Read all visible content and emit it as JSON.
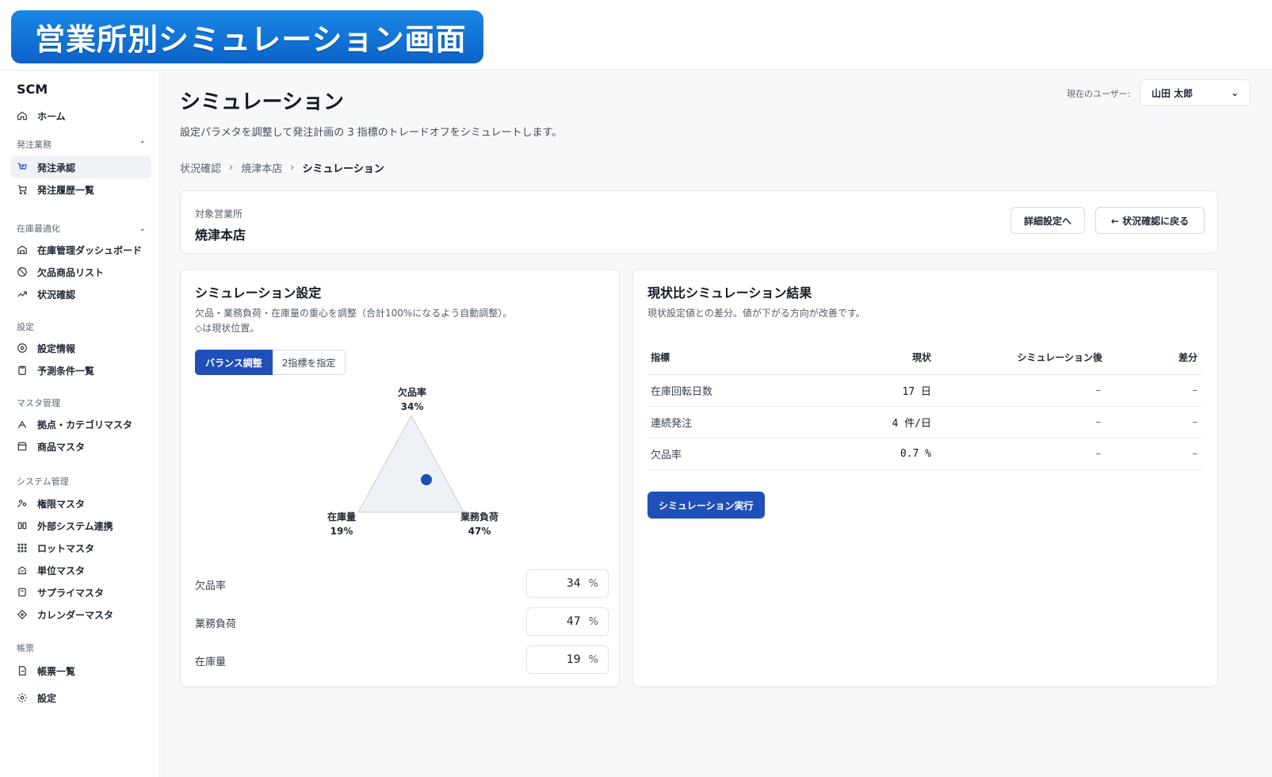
{
  "banner": {
    "title": "営業所別シミュレーション画面"
  },
  "sidebar": {
    "brand": "SCM",
    "home": "ホーム",
    "sections": [
      {
        "label": "発注業務",
        "items": [
          "発注承認",
          "発注履歴一覧"
        ]
      },
      {
        "label": "在庫最適化",
        "items": [
          "在庫管理ダッシュボード",
          "欠品商品リスト",
          "状況確認"
        ]
      },
      {
        "label": "設定",
        "items": [
          "設定情報",
          "予測条件一覧"
        ]
      },
      {
        "label": "マスタ管理",
        "items": [
          "拠点・カテゴリマスタ",
          "商品マスタ"
        ]
      },
      {
        "label": "システム管理",
        "items": [
          "権限マスタ",
          "外部システム連携",
          "ロットマスタ",
          "単位マスタ",
          "サプライマスタ",
          "カレンダーマスタ"
        ]
      },
      {
        "label": "帳票",
        "items": [
          "帳票一覧"
        ]
      }
    ],
    "settings": "設定"
  },
  "header": {
    "title": "シミュレーション",
    "description": "設定パラメタを調整して発注計画の 3 指標のトレードオフをシミュレートします。",
    "user_label": "現在のユーザー:",
    "user_name": "山田 太郎"
  },
  "breadcrumb": [
    "状況確認",
    "焼津本店",
    "シミュレーション"
  ],
  "office": {
    "label": "対象営業所",
    "name": "焼津本店",
    "detail_button": "詳細設定へ",
    "back_button": "← 状況確認に戻る"
  },
  "simulation": {
    "title": "シミュレーション設定",
    "description_line1": "欠品・業務負荷・在庫量の重心を調整（合計100%になるよう自動調整）。",
    "description_line2": "◇は現状位置。",
    "mode_tabs": [
      "バランス調整",
      "2指標を指定"
    ],
    "active_mode": "バランス調整",
    "vertices": {
      "top": {
        "name": "欠品率",
        "value": "34%"
      },
      "left": {
        "name": "在庫量",
        "value": "19%"
      },
      "right": {
        "name": "業務負荷",
        "value": "47%"
      }
    },
    "weights": [
      {
        "label": "欠品率",
        "value": "34",
        "unit": "%"
      },
      {
        "label": "業務負荷",
        "value": "47",
        "unit": "%"
      },
      {
        "label": "在庫量",
        "value": "19",
        "unit": "%"
      }
    ]
  },
  "results": {
    "title": "現状比シミュレーション結果",
    "description": "現状設定値との差分。値が下がる方向が改善です。",
    "columns": [
      "指標",
      "現状",
      "シミュレーション後",
      "差分"
    ],
    "rows": [
      {
        "metric": "在庫回転日数",
        "current": "17 日",
        "after": "–",
        "diff": "–"
      },
      {
        "metric": "連続発注",
        "current": "4 件/日",
        "after": "–",
        "diff": "–"
      },
      {
        "metric": "欠品率",
        "current": "0.7 %",
        "after": "–",
        "diff": "–"
      }
    ],
    "run_button": "シミュレーション実行"
  },
  "colors": {
    "primary": "#1f4fb8",
    "banner": "#0b63c9",
    "dot": "#1f4fb8"
  }
}
